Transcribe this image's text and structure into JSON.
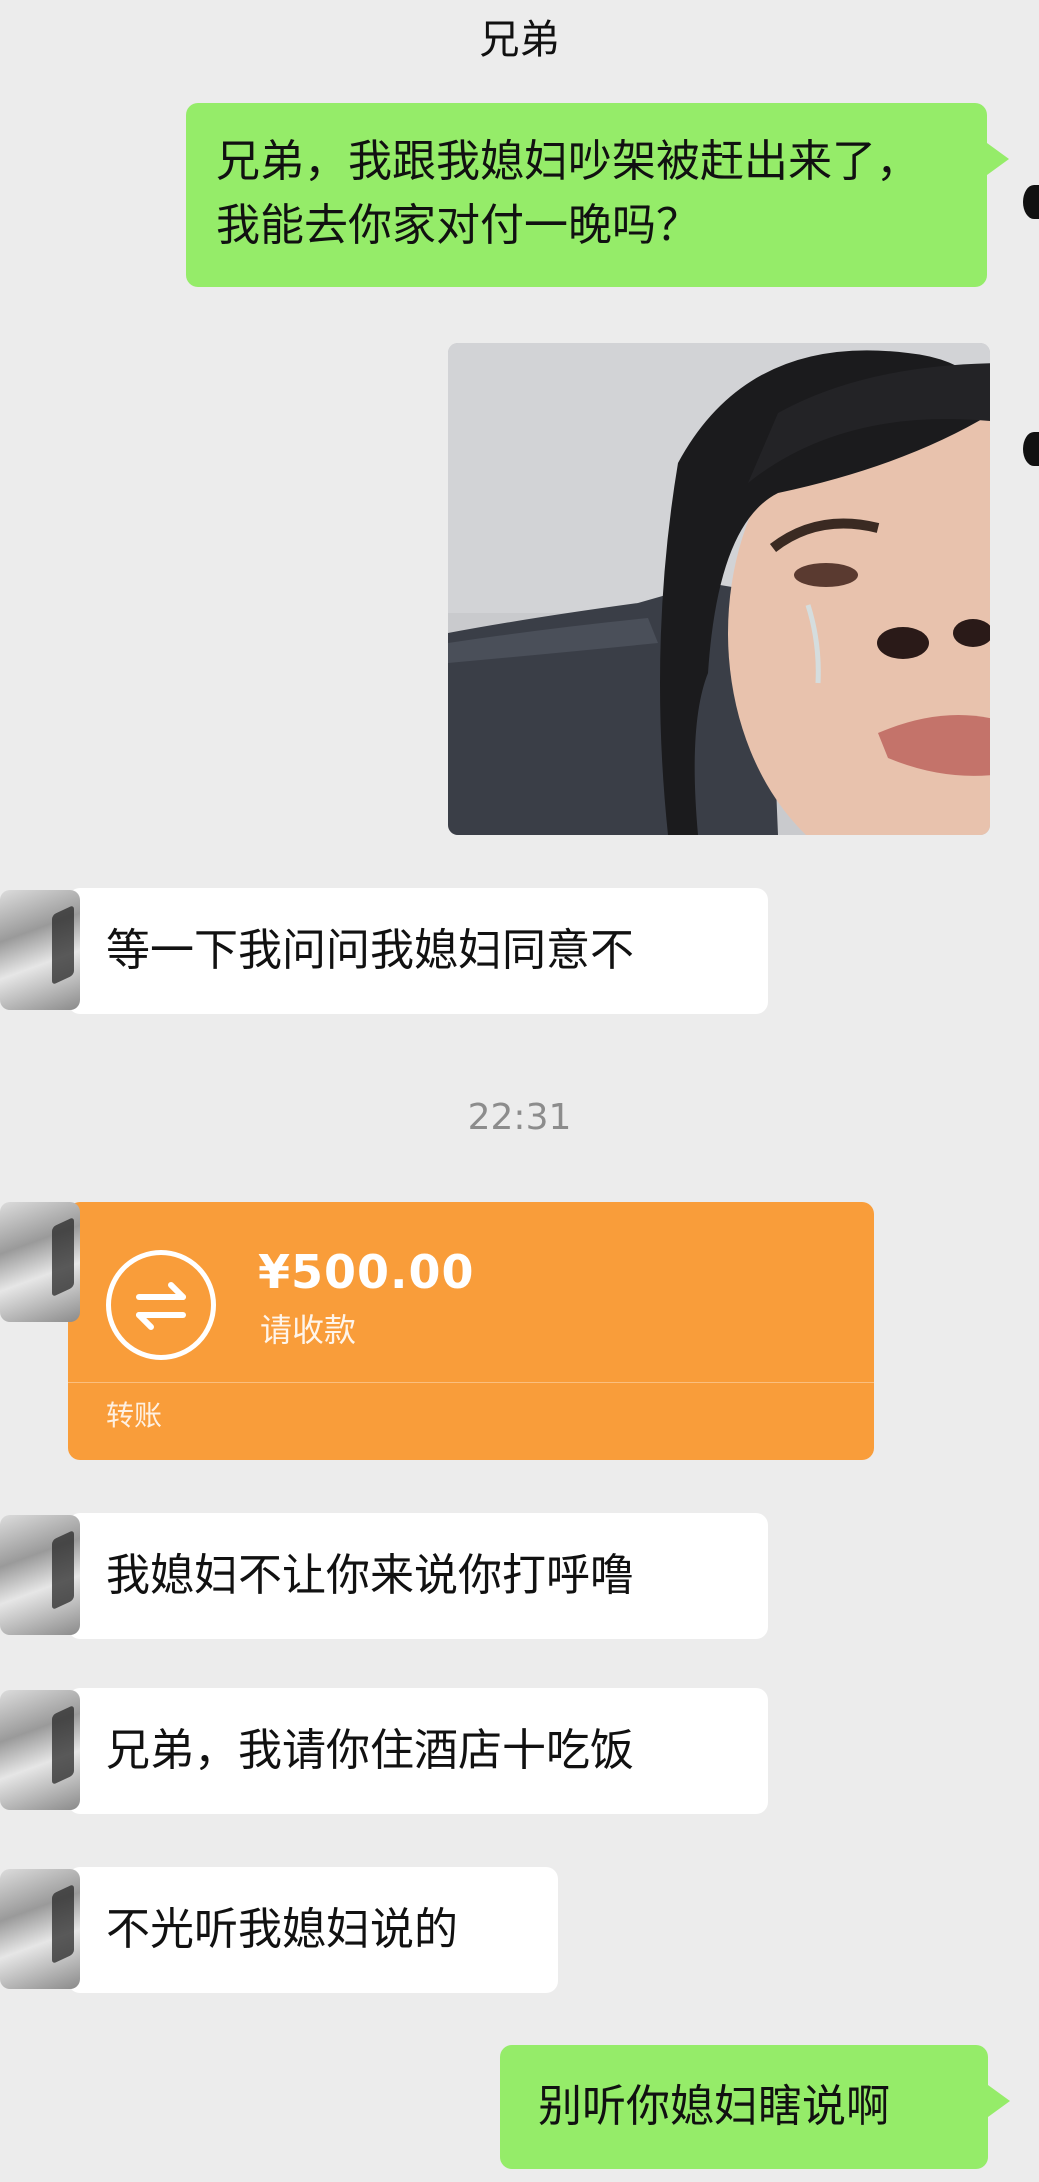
{
  "header": {
    "title": "兄弟"
  },
  "messages": {
    "m1": "兄弟，我跟我媳妇吵架被赶出来了，我能去你家对付一晚吗？",
    "m2": "等一下我问问我媳妇同意不",
    "m4": "我媳妇不让你来说你打呼噜",
    "m5": "兄弟，我请你住酒店十吃饭",
    "m6": "不光听我媳妇说的",
    "m7": "别听你媳妇瞎说啊"
  },
  "timestamp": "22:31",
  "transfer": {
    "amount": "¥500.00",
    "status": "请收款",
    "label": "转账",
    "icon": "transfer-arrows-icon",
    "color": "#f99d3a"
  },
  "colors": {
    "sent_bubble": "#95ec69",
    "received_bubble": "#ffffff",
    "background": "#ececec"
  }
}
